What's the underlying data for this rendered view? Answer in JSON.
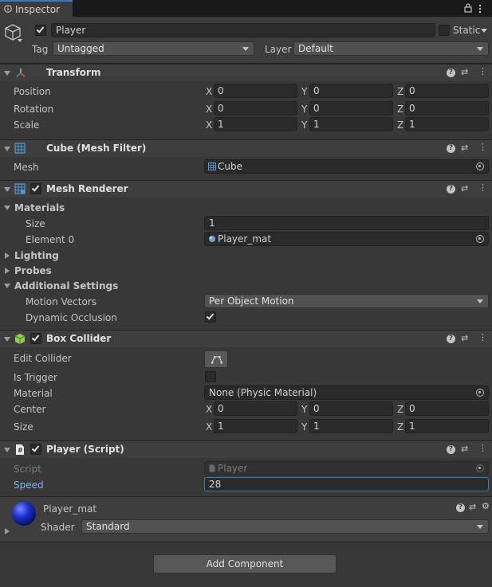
{
  "tab": {
    "label": "Inspector"
  },
  "object": {
    "name": "Player",
    "static_label": "Static",
    "tag_label": "Tag",
    "tag_value": "Untagged",
    "layer_label": "Layer",
    "layer_value": "Default"
  },
  "transform": {
    "title": "Transform",
    "position": {
      "label": "Position",
      "x": "0",
      "y": "0",
      "z": "0"
    },
    "rotation": {
      "label": "Rotation",
      "x": "0",
      "y": "0",
      "z": "0"
    },
    "scale": {
      "label": "Scale",
      "x": "1",
      "y": "1",
      "z": "1"
    }
  },
  "axes": {
    "x": "X",
    "y": "Y",
    "z": "Z"
  },
  "mesh_filter": {
    "title": "Cube (Mesh Filter)",
    "mesh_label": "Mesh",
    "mesh_value": "Cube"
  },
  "mesh_renderer": {
    "title": "Mesh Renderer",
    "materials_label": "Materials",
    "size_label": "Size",
    "size_value": "1",
    "element0_label": "Element 0",
    "element0_value": "Player_mat",
    "lighting_label": "Lighting",
    "probes_label": "Probes",
    "additional_label": "Additional Settings",
    "motion_vectors_label": "Motion Vectors",
    "motion_vectors_value": "Per Object Motion",
    "dynamic_occlusion_label": "Dynamic Occlusion"
  },
  "box_collider": {
    "title": "Box Collider",
    "edit_collider_label": "Edit Collider",
    "is_trigger_label": "Is Trigger",
    "material_label": "Material",
    "material_value": "None (Physic Material)",
    "center": {
      "label": "Center",
      "x": "0",
      "y": "0",
      "z": "0"
    },
    "size": {
      "label": "Size",
      "x": "1",
      "y": "1",
      "z": "1"
    }
  },
  "player_script": {
    "title": "Player (Script)",
    "script_label": "Script",
    "script_value": "Player",
    "speed_label": "Speed",
    "speed_value": "28"
  },
  "material": {
    "name": "Player_mat",
    "shader_label": "Shader",
    "shader_value": "Standard"
  },
  "add_component": {
    "label": "Add Component"
  },
  "colors": {
    "accent": "#3a79bb",
    "panel": "#383838",
    "header": "#3e3e3e",
    "field": "#2a2a2a"
  }
}
